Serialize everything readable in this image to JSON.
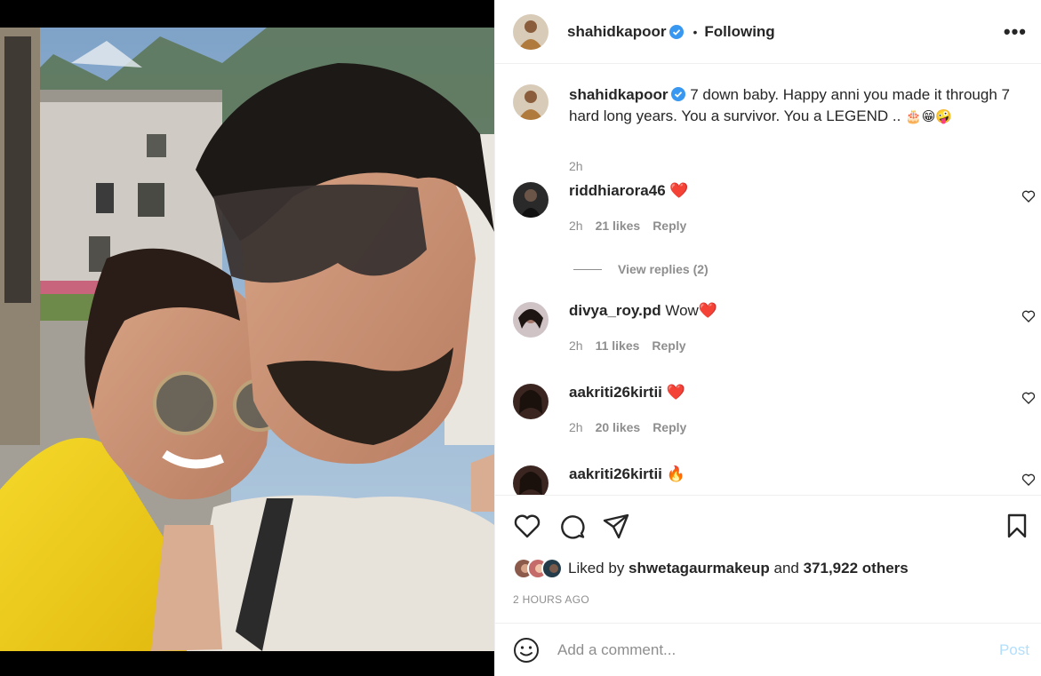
{
  "post": {
    "image_alt": "Couple selfie photo",
    "author": "shahidkapoor",
    "verified": true,
    "follow_state": "Following",
    "dot": "•",
    "more": "•••"
  },
  "caption": {
    "username": "shahidkapoor",
    "text": " 7 down baby. Happy anni you made it through 7 hard long years. You a survivor. You a LEGEND .. ",
    "emojis": "🎂😁🤪",
    "time": "2h"
  },
  "comments": [
    {
      "username": "riddhiarora46",
      "text": " ❤️",
      "time": "2h",
      "likes": "21 likes",
      "reply": "Reply"
    },
    {
      "username": "divya_roy.pd",
      "text": " Wow❤️",
      "time": "2h",
      "likes": "11 likes",
      "reply": "Reply"
    },
    {
      "username": "aakriti26kirtii",
      "text": " ❤️",
      "time": "2h",
      "likes": "20 likes",
      "reply": "Reply"
    },
    {
      "username": "aakriti26kirtii",
      "text": " 🔥",
      "time": "",
      "likes": "",
      "reply": ""
    }
  ],
  "view_replies": "View replies (2)",
  "actions": {
    "like_icon": "heart-icon",
    "comment_icon": "comment-icon",
    "share_icon": "paper-plane-icon",
    "save_icon": "bookmark-icon"
  },
  "likes": {
    "prefix": "Liked by ",
    "user": "shwetagaurmakeup",
    "middle": " and ",
    "count": "371,922 others"
  },
  "time_ago": "2 HOURS AGO",
  "add_comment": {
    "placeholder": "Add a comment...",
    "post_label": "Post",
    "post_color": "#b2dffc"
  },
  "colors": {
    "verified": "#3897f0",
    "heart_red": "#ed4956",
    "muted": "#8e8e8e"
  }
}
